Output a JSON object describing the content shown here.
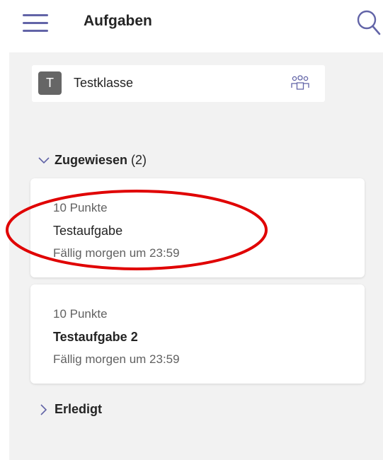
{
  "header": {
    "title": "Aufgaben",
    "menu_icon": "hamburger-menu-icon",
    "search_icon": "search-icon",
    "accent_color": "#6264a7"
  },
  "class_selector": {
    "avatar_letter": "T",
    "name": "Testklasse",
    "icon": "people-icon"
  },
  "sections": {
    "assigned": {
      "title": "Zugewiesen",
      "count": "(2)",
      "expanded": true
    },
    "done": {
      "title": "Erledigt",
      "expanded": false
    }
  },
  "assignments": [
    {
      "points": "10 Punkte",
      "name": "Testaufgabe",
      "due": "Fällig morgen um 23:59"
    },
    {
      "points": "10 Punkte",
      "name": "Testaufgabe 2",
      "due": "Fällig morgen um 23:59"
    }
  ],
  "annotation": {
    "shape": "ellipse",
    "color": "#e00000"
  }
}
